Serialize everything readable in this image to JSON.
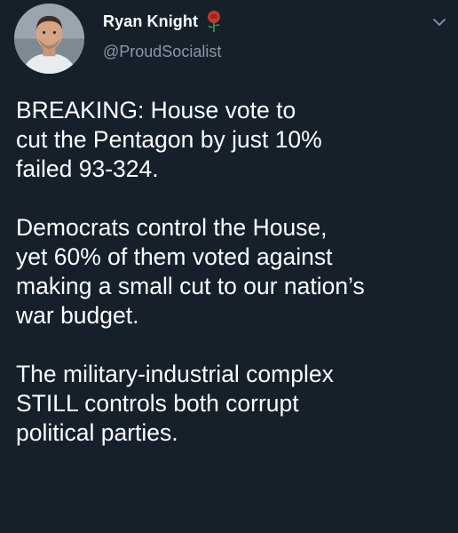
{
  "author": {
    "display_name": "Ryan Knight",
    "handle": "@ProudSocialist",
    "badge_icon": "rose-emoji-icon",
    "menu_icon": "chevron-down-icon"
  },
  "tweet": {
    "paragraphs": [
      [
        "BREAKING: House vote to",
        "cut the Pentagon by just 10%",
        "failed 93-324."
      ],
      [
        "Democrats control the House,",
        "yet 60% of them voted against",
        "making a small cut to our nation’s",
        "war budget."
      ],
      [
        "The military-industrial complex",
        "STILL controls both corrupt",
        "political parties."
      ]
    ]
  },
  "colors": {
    "background": "#15202b",
    "text": "#ffffff",
    "secondary_text": "#8899a6",
    "rose": "#c0392b"
  }
}
